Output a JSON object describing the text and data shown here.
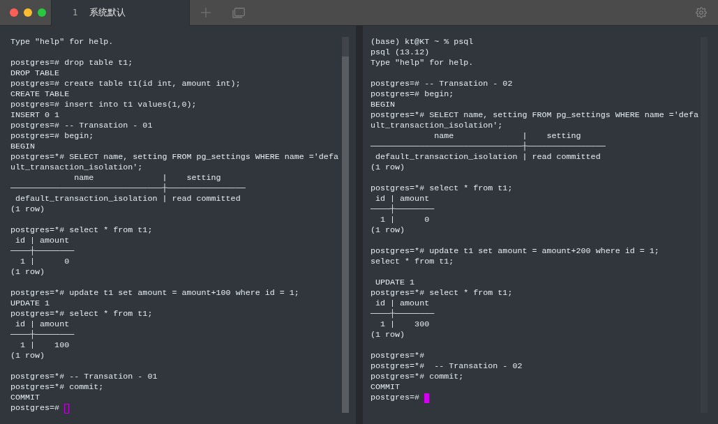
{
  "tabs": [
    {
      "index": "1",
      "title": "系统默认",
      "selected": true
    }
  ],
  "panes": [
    {
      "focused": false,
      "blocks": [
        [
          "Type \"help\" for help."
        ],
        [
          "postgres=# drop table t1;",
          "DROP TABLE",
          "postgres=# create table t1(id int, amount int);",
          "CREATE TABLE",
          "postgres=# insert into t1 values(1,0);",
          "INSERT 0 1",
          "postgres=# -- Transation - 01",
          "postgres=# begin;",
          "BEGIN",
          "postgres=*# SELECT name, setting FROM pg_settings WHERE name ='defa",
          "ult_transaction_isolation';",
          "             name              |    setting",
          "───────────────────────────────┼────────────────",
          " default_transaction_isolation | read committed",
          "(1 row)"
        ],
        [
          "postgres=*# select * from t1;",
          " id | amount",
          "────┼────────",
          "  1 |      0",
          "(1 row)"
        ],
        [
          "postgres=*# update t1 set amount = amount+100 where id = 1;",
          "UPDATE 1",
          "postgres=*# select * from t1;",
          " id | amount",
          "────┼────────",
          "  1 |    100",
          "(1 row)"
        ],
        [
          "postgres=*# -- Transation - 01",
          "postgres=*# commit;",
          "COMMIT",
          "postgres=#"
        ]
      ]
    },
    {
      "focused": true,
      "blocks": [
        [
          "(base) kt@KT ~ % psql",
          "psql (13.12)",
          "Type \"help\" for help."
        ],
        [
          "postgres=# -- Transation - 02",
          "postgres=# begin;",
          "BEGIN",
          "postgres=*# SELECT name, setting FROM pg_settings WHERE name ='defa",
          "ult_transaction_isolation';",
          "             name              |    setting",
          "───────────────────────────────┼────────────────",
          " default_transaction_isolation | read committed",
          "(1 row)"
        ],
        [
          "postgres=*# select * from t1;",
          " id | amount",
          "────┼────────",
          "  1 |      0",
          "(1 row)"
        ],
        [
          "postgres=*# update t1 set amount = amount+200 where id = 1;",
          "select * from t1;"
        ],
        [
          " UPDATE 1",
          "postgres=*# select * from t1;",
          " id | amount",
          "────┼────────",
          "  1 |    300",
          "(1 row)"
        ],
        [
          "postgres=*#",
          "postgres=*#  -- Transation - 02",
          "postgres=*# commit;",
          "COMMIT",
          "postgres=#"
        ]
      ]
    }
  ]
}
